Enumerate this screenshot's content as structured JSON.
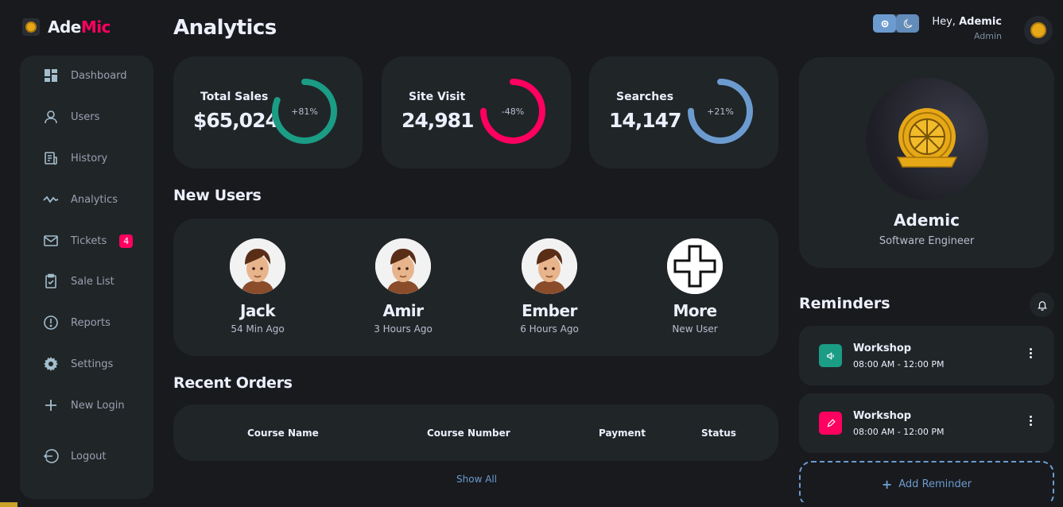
{
  "brand": {
    "name_part1": "Ade",
    "name_part2": "Mic"
  },
  "sidebar": {
    "items": [
      {
        "label": "Dashboard",
        "icon": "dashboard-icon"
      },
      {
        "label": "Users",
        "icon": "user-icon"
      },
      {
        "label": "History",
        "icon": "receipt-icon"
      },
      {
        "label": "Analytics",
        "icon": "analytics-icon"
      },
      {
        "label": "Tickets",
        "icon": "mail-icon",
        "badge": "4"
      },
      {
        "label": "Sale List",
        "icon": "clipboard-icon"
      },
      {
        "label": "Reports",
        "icon": "report-icon"
      },
      {
        "label": "Settings",
        "icon": "gear-icon"
      },
      {
        "label": "New Login",
        "icon": "plus-icon"
      },
      {
        "label": "Logout",
        "icon": "logout-icon"
      }
    ]
  },
  "header": {
    "title": "Analytics",
    "greeting": "Hey,",
    "user_name": "Ademic",
    "user_role": "Admin"
  },
  "stats": [
    {
      "label": "Total Sales",
      "value": "$65,024",
      "change": "+81%",
      "color": "#1b9c85",
      "fill": 0.81
    },
    {
      "label": "Site Visit",
      "value": "24,981",
      "change": "-48%",
      "color": "#ff0060",
      "fill": 0.75
    },
    {
      "label": "Searches",
      "value": "14,147",
      "change": "+21%",
      "color": "#6c9bcf",
      "fill": 0.75
    }
  ],
  "new_users": {
    "title": "New Users",
    "users": [
      {
        "name": "Jack",
        "time": "54 Min Ago"
      },
      {
        "name": "Amir",
        "time": "3 Hours Ago"
      },
      {
        "name": "Ember",
        "time": "6 Hours Ago"
      },
      {
        "name": "More",
        "time": "New User"
      }
    ]
  },
  "orders": {
    "title": "Recent Orders",
    "columns": [
      "Course Name",
      "Course Number",
      "Payment",
      "Status"
    ],
    "show_all": "Show All"
  },
  "profile": {
    "name": "Ademic",
    "role": "Software Engineer"
  },
  "reminders": {
    "title": "Reminders",
    "items": [
      {
        "title": "Workshop",
        "time": "08:00 AM - 12:00 PM",
        "color": "#1b9c85",
        "icon": "volume-icon"
      },
      {
        "title": "Workshop",
        "time": "08:00 AM - 12:00 PM",
        "color": "#ff0060",
        "icon": "edit-icon"
      }
    ],
    "add_label": "Add Reminder"
  },
  "colors": {
    "primary": "#6c9bcf",
    "danger": "#ff0060",
    "success": "#1b9c85",
    "background": "#181a1e",
    "card": "#202528"
  }
}
